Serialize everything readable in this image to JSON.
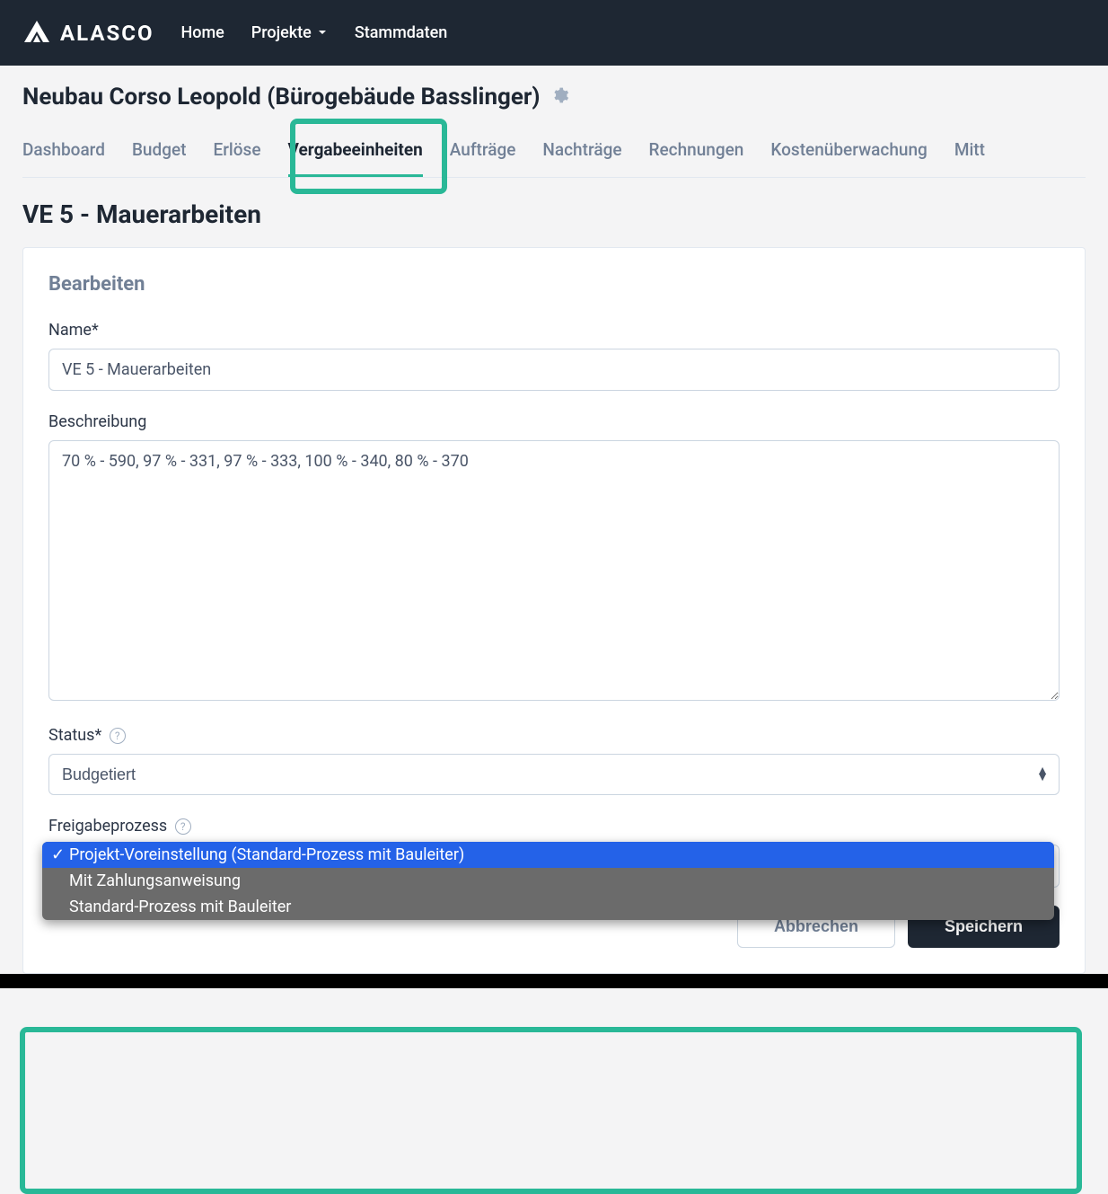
{
  "brand": "ALASCO",
  "topnav": {
    "home": "Home",
    "projekte": "Projekte",
    "stammdaten": "Stammdaten"
  },
  "page_title": "Neubau Corso Leopold (Bürogebäude Basslinger)",
  "tabs": {
    "dashboard": "Dashboard",
    "budget": "Budget",
    "erloese": "Erlöse",
    "vergabeeinheiten": "Vergabeeinheiten",
    "auftraege": "Aufträge",
    "nachtraege": "Nachträge",
    "rechnungen": "Rechnungen",
    "kostenueberwachung": "Kostenüberwachung",
    "mitt": "Mitt"
  },
  "section_title": "VE 5 - Mauerarbeiten",
  "card": {
    "title": "Bearbeiten",
    "name_label": "Name*",
    "name_value": "VE 5 - Mauerarbeiten",
    "beschreibung_label": "Beschreibung",
    "beschreibung_value": "70 % - 590, 97 % - 331, 97 % - 333, 100 % - 340, 80 % - 370",
    "status_label": "Status*",
    "status_value": "Budgetiert",
    "freigabe_label": "Freigabeprozess",
    "freigabe_options": {
      "opt1": "Projekt-Voreinstellung (Standard-Prozess mit Bauleiter)",
      "opt2": "Mit Zahlungsanweisung",
      "opt3": "Standard-Prozess mit Bauleiter"
    },
    "cancel": "Abbrechen",
    "save": "Speichern"
  }
}
